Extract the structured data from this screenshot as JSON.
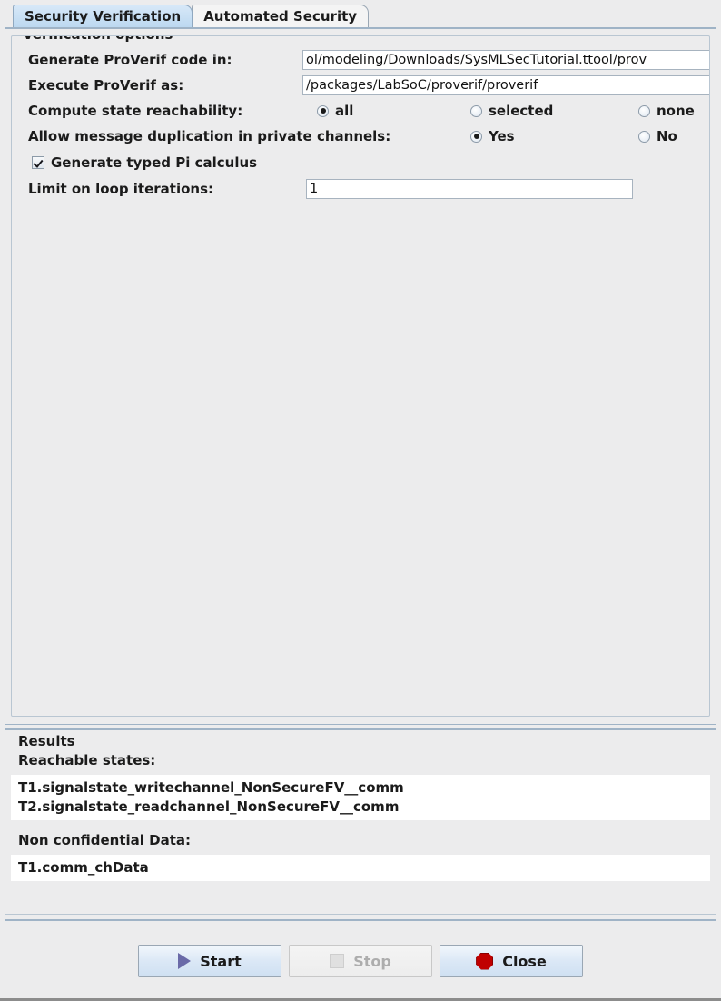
{
  "tabs": [
    {
      "label": "Security Verification",
      "selected": true
    },
    {
      "label": "Automated Security",
      "selected": false
    }
  ],
  "verification": {
    "group_title": "Verification options",
    "generate_label": "Generate ProVerif code in:",
    "generate_value": "ol/modeling/Downloads/SysMLSecTutorial.ttool/prov",
    "execute_label": "Execute ProVerif as:",
    "execute_value": "/packages/LabSoC/proverif/proverif",
    "reachability_label": "Compute state reachability:",
    "reachability_options": [
      {
        "label": "all",
        "checked": true
      },
      {
        "label": "selected",
        "checked": false
      },
      {
        "label": "none",
        "checked": false
      }
    ],
    "duplication_label": "Allow message duplication in private channels:",
    "duplication_options": [
      {
        "label": "Yes",
        "checked": true
      },
      {
        "label": "No",
        "checked": false
      }
    ],
    "typed_pi_label": "Generate typed Pi calculus",
    "typed_pi_checked": true,
    "loop_label": "Limit on loop iterations:",
    "loop_value": "1"
  },
  "results": {
    "group_title": "Results",
    "reachable_heading": "Reachable states:",
    "reachable_states": [
      "T1.signalstate_writechannel_NonSecureFV__comm",
      "T2.signalstate_readchannel_NonSecureFV__comm"
    ],
    "nonconfidential_heading": "Non confidential Data:",
    "nonconfidential_items": [
      "T1.comm_chData"
    ]
  },
  "buttons": {
    "start": "Start",
    "stop": "Stop",
    "close": "Close"
  },
  "colors": {
    "tab_selected": "#c6dcf2",
    "panel_bg": "#ececed",
    "start_icon": "#6a6aa8",
    "close_icon": "#c00000",
    "field_bg": "#ffffff"
  }
}
